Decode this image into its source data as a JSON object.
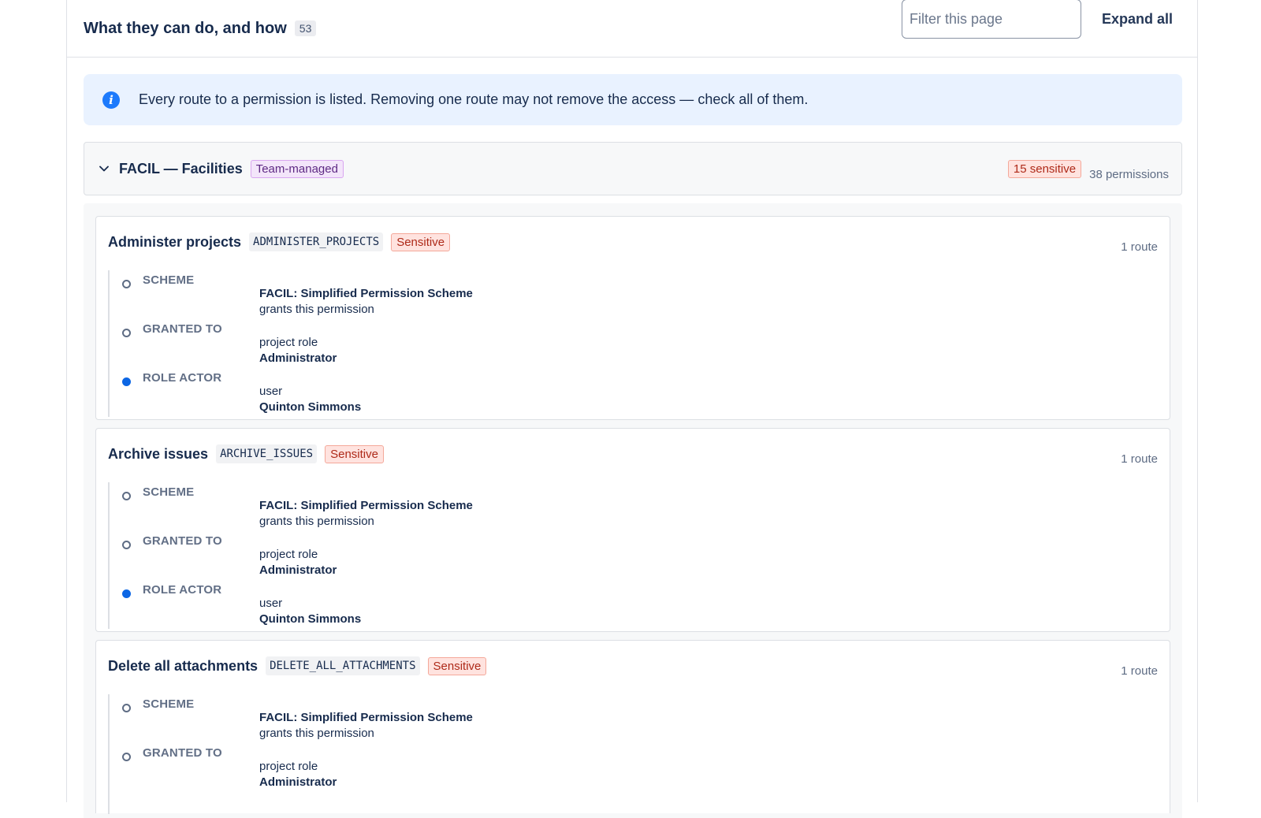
{
  "header": {
    "title": "What they can do, and how",
    "count": "53",
    "filter_placeholder": "Filter this page",
    "expand_label": "Expand all"
  },
  "banner": {
    "text": "Every route to a permission is listed. Removing one route may not remove the access — check all of them."
  },
  "project": {
    "title": "FACIL — Facilities",
    "type_badge": "Team-managed",
    "sensitive_badge": "15 sensitive",
    "permission_count": "38 permissions"
  },
  "permissions": [
    {
      "name": "Administer projects",
      "key": "ADMINISTER_PROJECTS",
      "badge": "Sensitive",
      "routes": "1 route",
      "steps": [
        {
          "label": "SCHEME",
          "strong": "FACIL: Simplified Permission Scheme",
          "detail": "grants this permission",
          "filled": false
        },
        {
          "label": "GRANTED TO",
          "detail": "project role",
          "strong": "Administrator",
          "filled": false
        },
        {
          "label": "ROLE ACTOR",
          "detail": "user",
          "strong": "Quinton Simmons",
          "filled": true
        }
      ]
    },
    {
      "name": "Archive issues",
      "key": "ARCHIVE_ISSUES",
      "badge": "Sensitive",
      "routes": "1 route",
      "steps": [
        {
          "label": "SCHEME",
          "strong": "FACIL: Simplified Permission Scheme",
          "detail": "grants this permission",
          "filled": false
        },
        {
          "label": "GRANTED TO",
          "detail": "project role",
          "strong": "Administrator",
          "filled": false
        },
        {
          "label": "ROLE ACTOR",
          "detail": "user",
          "strong": "Quinton Simmons",
          "filled": true
        }
      ]
    },
    {
      "name": "Delete all attachments",
      "key": "DELETE_ALL_ATTACHMENTS",
      "badge": "Sensitive",
      "routes": "1 route",
      "steps": [
        {
          "label": "SCHEME",
          "strong": "FACIL: Simplified Permission Scheme",
          "detail": "grants this permission",
          "filled": false
        },
        {
          "label": "GRANTED TO",
          "detail": "project role",
          "strong": "Administrator",
          "filled": false
        }
      ]
    }
  ]
}
